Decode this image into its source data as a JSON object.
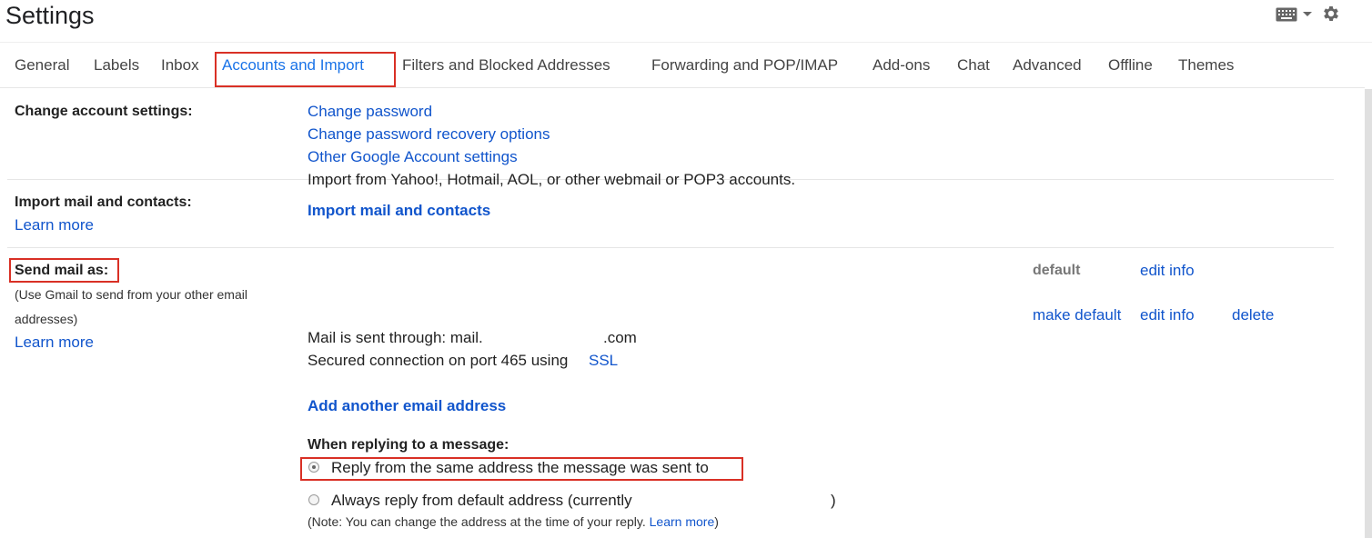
{
  "header": {
    "title": "Settings",
    "keyboard_icon": "keyboard-icon",
    "settings_icon": "gear-icon"
  },
  "tabs": [
    {
      "label": "General"
    },
    {
      "label": "Labels"
    },
    {
      "label": "Inbox"
    },
    {
      "label": "Accounts and Import",
      "active": true
    },
    {
      "label": "Filters and Blocked Addresses"
    },
    {
      "label": "Forwarding and POP/IMAP"
    },
    {
      "label": "Add-ons"
    },
    {
      "label": "Chat"
    },
    {
      "label": "Advanced"
    },
    {
      "label": "Offline"
    },
    {
      "label": "Themes"
    }
  ],
  "change_account": {
    "label": "Change account settings:",
    "links": [
      "Change password",
      "Change password recovery options",
      "Other Google Account settings"
    ]
  },
  "import": {
    "label": "Import mail and contacts:",
    "learn_more": "Learn more",
    "description": "Import from Yahoo!, Hotmail, AOL, or other webmail or POP3 accounts.",
    "action": "Import mail and contacts"
  },
  "send_mail": {
    "label": "Send mail as:",
    "note_line1": "(Use Gmail to send from your other email",
    "note_line2": "addresses)",
    "learn_more": "Learn more",
    "row1": {
      "default": "default",
      "edit": "edit info"
    },
    "row2": {
      "make_default": "make default",
      "edit": "edit info",
      "delete": "delete"
    },
    "sent_through_prefix": "Mail is sent through: mail.",
    "sent_through_suffix": ".com",
    "secured_prefix": "Secured connection on port 465 using",
    "ssl": "SSL",
    "add_address": "Add another email address",
    "replying_label": "When replying to a message:",
    "option1": "Reply from the same address the message was sent to",
    "option2_prefix": "Always reply from default address (currently",
    "option2_suffix": ")",
    "note_prefix": "(Note: You can change the address at the time of your reply.",
    "note_link": "Learn more",
    "note_suffix": ")"
  },
  "colors": {
    "accent": "#1a73e8",
    "link": "#1155cc",
    "highlight": "#d93025"
  }
}
